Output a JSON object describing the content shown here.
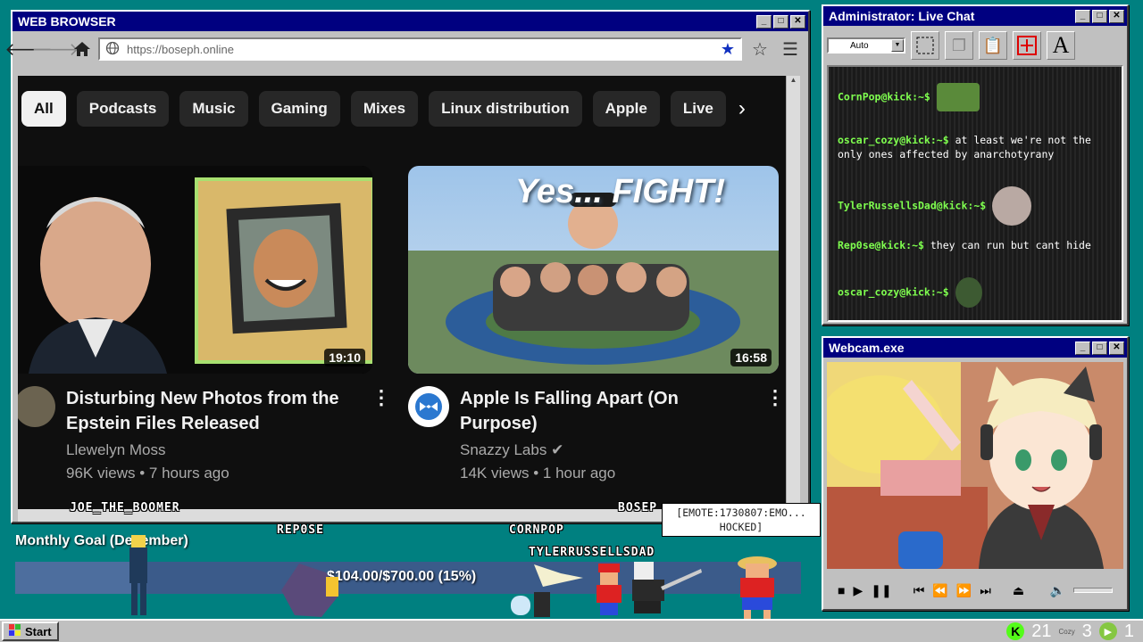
{
  "browser": {
    "title": "WEB BROWSER",
    "url": "https://boseph.online",
    "controls": {
      "minimize": "_",
      "maximize": "□",
      "close": "✕"
    }
  },
  "chips": [
    {
      "label": "All"
    },
    {
      "label": "Podcasts"
    },
    {
      "label": "Music"
    },
    {
      "label": "Gaming"
    },
    {
      "label": "Mixes"
    },
    {
      "label": "Linux distribution"
    },
    {
      "label": "Apple"
    },
    {
      "label": "Live"
    }
  ],
  "videos": [
    {
      "title": "Disturbing New Photos from the Epstein Files Released",
      "channel": "Llewelyn Moss",
      "views": "96K views",
      "age": "7 hours ago",
      "duration": "19:10"
    },
    {
      "title": "Apple Is Falling Apart (On Purpose)",
      "channel": "Snazzy Labs",
      "views": "14K views",
      "age": "1 hour ago",
      "duration": "16:58",
      "thumb_text": "Yes... FIGHT!"
    }
  ],
  "chat": {
    "title": "Administrator: Live Chat",
    "size_select": "Auto",
    "messages": [
      {
        "user": "CornPop@kick:~$",
        "text": ""
      },
      {
        "user": "oscar_cozy@kick:~$",
        "text": "at least we're not the only ones affected by anarchotyrany"
      },
      {
        "user": "TylerRussellsDad@kick:~$",
        "text": ""
      },
      {
        "user": "Rep0se@kick:~$",
        "text": "they can run but cant hide"
      },
      {
        "user": "oscar_cozy@kick:~$",
        "text": ""
      }
    ],
    "tool_font": "A"
  },
  "webcam": {
    "title": "Webcam.exe"
  },
  "goal": {
    "label": "Monthly Goal (December)",
    "text": "$104.00/$700.00 (15%)",
    "progress": 0.15
  },
  "sprites": {
    "joe": "JOE_THE_BOOMER",
    "repose": "REP0SE",
    "cornpop": "CORNPOP",
    "tyler": "TYLERRUSSELLSDAD",
    "boseph": "BOSEP",
    "bubble": "[EMOTE:1730807:EMO... HOCKED]"
  },
  "taskbar": {
    "start": "Start",
    "kick_count": "21",
    "tray_label": "Cozy",
    "count_two": "3",
    "rumble_count": "1"
  }
}
